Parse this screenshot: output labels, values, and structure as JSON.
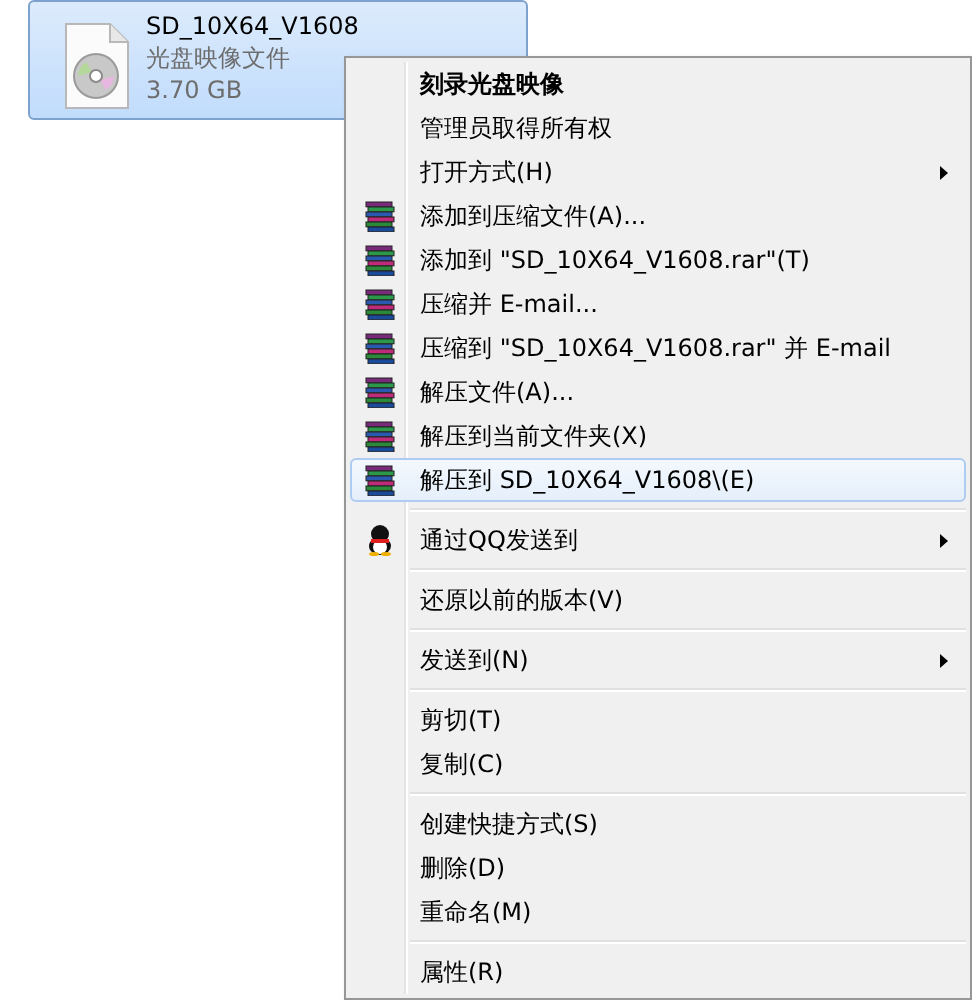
{
  "file": {
    "name": "SD_10X64_V1608",
    "type": "光盘映像文件",
    "size": "3.70 GB",
    "selected": true
  },
  "menu": [
    {
      "kind": "item",
      "label": "刻录光盘映像",
      "default": true,
      "submenu": false,
      "selected": false
    },
    {
      "kind": "item",
      "label": "管理员取得所有权",
      "default": false,
      "submenu": false,
      "selected": false
    },
    {
      "kind": "item",
      "label": "打开方式(H)",
      "default": false,
      "submenu": true,
      "selected": false
    },
    {
      "kind": "archive_item",
      "label": "添加到压缩文件(A)...",
      "default": false,
      "submenu": false,
      "selected": false
    },
    {
      "kind": "archive_item",
      "label": "添加到 \"SD_10X64_V1608.rar\"(T)",
      "default": false,
      "submenu": false,
      "selected": false
    },
    {
      "kind": "archive_item",
      "label": "压缩并 E-mail...",
      "default": false,
      "submenu": false,
      "selected": false
    },
    {
      "kind": "archive_item",
      "label": "压缩到 \"SD_10X64_V1608.rar\" 并 E-mail",
      "default": false,
      "submenu": false,
      "selected": false
    },
    {
      "kind": "archive_item",
      "label": "解压文件(A)...",
      "default": false,
      "submenu": false,
      "selected": false
    },
    {
      "kind": "archive_item",
      "label": "解压到当前文件夹(X)",
      "default": false,
      "submenu": false,
      "selected": false
    },
    {
      "kind": "archive_item",
      "label": "解压到 SD_10X64_V1608\\(E)",
      "default": false,
      "submenu": false,
      "selected": true
    },
    {
      "kind": "separator"
    },
    {
      "kind": "qq_item",
      "label": "通过QQ发送到",
      "default": false,
      "submenu": true,
      "selected": false
    },
    {
      "kind": "separator"
    },
    {
      "kind": "item",
      "label": "还原以前的版本(V)",
      "default": false,
      "submenu": false,
      "selected": false
    },
    {
      "kind": "separator"
    },
    {
      "kind": "item",
      "label": "发送到(N)",
      "default": false,
      "submenu": true,
      "selected": false
    },
    {
      "kind": "separator"
    },
    {
      "kind": "item",
      "label": "剪切(T)",
      "default": false,
      "submenu": false,
      "selected": false
    },
    {
      "kind": "item",
      "label": "复制(C)",
      "default": false,
      "submenu": false,
      "selected": false
    },
    {
      "kind": "separator"
    },
    {
      "kind": "item",
      "label": "创建快捷方式(S)",
      "default": false,
      "submenu": false,
      "selected": false
    },
    {
      "kind": "item",
      "label": "删除(D)",
      "default": false,
      "submenu": false,
      "selected": false
    },
    {
      "kind": "item",
      "label": "重命名(M)",
      "default": false,
      "submenu": false,
      "selected": false
    },
    {
      "kind": "separator"
    },
    {
      "kind": "item",
      "label": "属性(R)",
      "default": false,
      "submenu": false,
      "selected": false
    }
  ]
}
